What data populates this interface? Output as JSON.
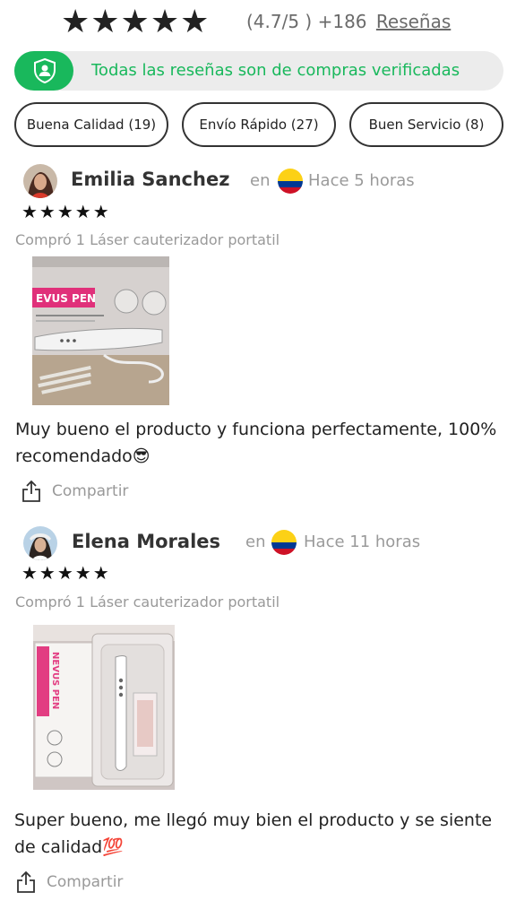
{
  "rating": {
    "stars": "★★★★★",
    "score_text": "(4.7/5 ) +186",
    "reviews_label": "Reseñas"
  },
  "verified": {
    "text": "Todas las reseñas son de compras verificadas",
    "color": "#19b85c"
  },
  "filters": [
    {
      "label": "Buena Calidad (19)"
    },
    {
      "label": "Envío Rápido (27)"
    },
    {
      "label": "Buen Servicio (8)"
    }
  ],
  "reviews": [
    {
      "name": "Emilia Sanchez",
      "en_label": "en",
      "time": "Hace 5 horas",
      "stars": "★★★★★",
      "purchase": "Compró 1 Láser cauterizador portatil",
      "product_print": "EVUS PEN",
      "text": "Muy bueno el producto y funciona perfectamente, 100% recomendado😎",
      "share_label": "Compartir"
    },
    {
      "name": "Elena Morales",
      "en_label": "en",
      "time": "Hace 11 horas",
      "stars": "★★★★★",
      "purchase": "Compró 1 Láser cauterizador portatil",
      "product_print": "NEVUS PEN",
      "text": "Super bueno, me llegó muy bien el producto y se siente de calidad💯",
      "share_label": "Compartir"
    }
  ]
}
